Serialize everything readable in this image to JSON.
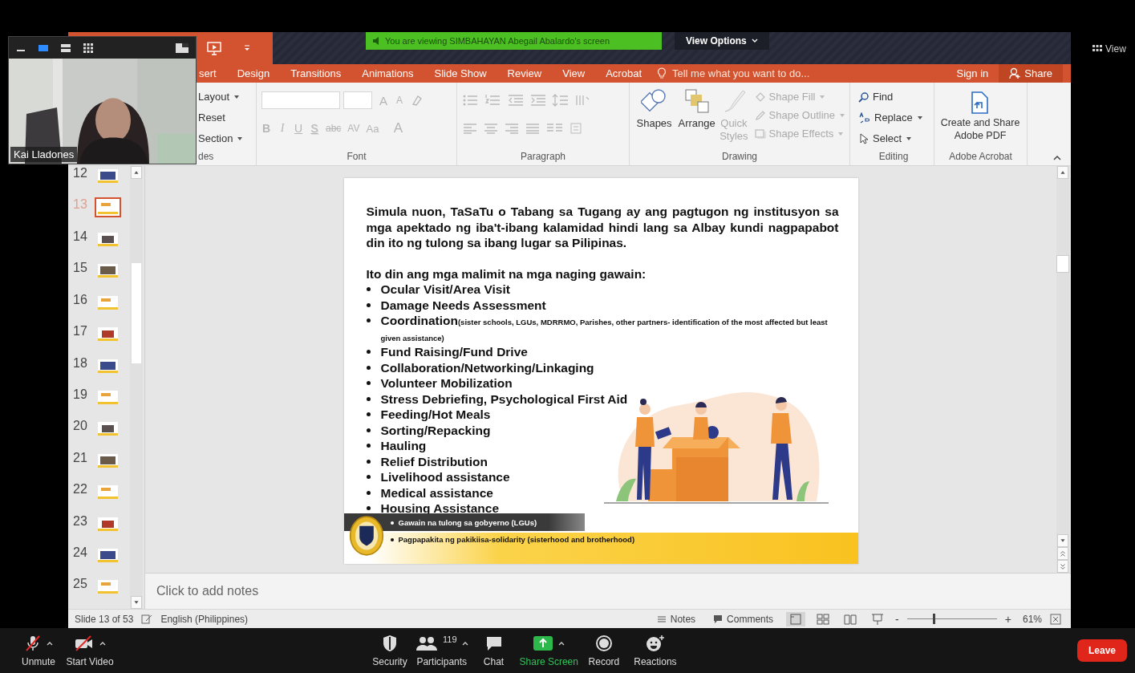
{
  "meeting": {
    "banner": "You are viewing SIMBAHAYAN  Abegail Abalardo's screen",
    "view_options": "View Options",
    "view_button": "View"
  },
  "video_tile": {
    "name": "Kai Lladones"
  },
  "tabs": [
    {
      "label": "sert",
      "selected": false
    },
    {
      "label": "Design",
      "selected": false
    },
    {
      "label": "Transitions",
      "selected": false
    },
    {
      "label": "Animations",
      "selected": false
    },
    {
      "label": "Slide Show",
      "selected": false
    },
    {
      "label": "Review",
      "selected": false
    },
    {
      "label": "View",
      "selected": false
    },
    {
      "label": "Acrobat",
      "selected": false
    }
  ],
  "tell_me": {
    "placeholder": "Tell me what you want to do..."
  },
  "sign_in": "Sign in",
  "share": "Share",
  "ribbon": {
    "slides_group": {
      "label": "des",
      "items": [
        {
          "label": "Layout",
          "menu": true
        },
        {
          "label": "Reset",
          "menu": false
        },
        {
          "label": "Section",
          "menu": true
        }
      ]
    },
    "font_group": {
      "label": "Font",
      "disabled": true,
      "size_buttons": [
        {
          "label": "A",
          "kind": "grow"
        },
        {
          "label": "A",
          "kind": "shrink"
        }
      ],
      "format_buttons": [
        {
          "label": "B",
          "kind": "bold"
        },
        {
          "label": "I",
          "kind": "italic"
        },
        {
          "label": "U",
          "kind": "underline"
        },
        {
          "label": "S",
          "kind": "shadow"
        },
        {
          "label": "abc",
          "kind": "strike"
        },
        {
          "label": "AV",
          "kind": "spacing"
        },
        {
          "label": "Aa",
          "kind": "case"
        },
        {
          "label": "A",
          "kind": "color"
        }
      ]
    },
    "paragraph_group": {
      "label": "Paragraph",
      "disabled": true
    },
    "drawing_group": {
      "label": "Drawing",
      "big_buttons": [
        {
          "label": "Shapes",
          "kind": "shapes",
          "disabled": false
        },
        {
          "label": "Arrange",
          "kind": "arrange",
          "disabled": false
        },
        {
          "label": "Quick Styles",
          "kind": "styles",
          "disabled": true
        }
      ],
      "small_buttons": [
        {
          "label": "Shape Fill",
          "kind": "fill",
          "disabled": true
        },
        {
          "label": "Shape Outline",
          "kind": "outline",
          "disabled": true
        },
        {
          "label": "Shape Effects",
          "kind": "effects",
          "disabled": true
        }
      ]
    },
    "editing_group": {
      "label": "Editing",
      "items": [
        {
          "label": "Find",
          "kind": "find",
          "menu": false
        },
        {
          "label": "Replace",
          "kind": "replace",
          "menu": true
        },
        {
          "label": "Select",
          "kind": "select",
          "menu": true
        }
      ]
    },
    "acrobat_group": {
      "label": "Adobe Acrobat",
      "button": "Create and Share Adobe PDF"
    }
  },
  "slides": [
    {
      "number": "12",
      "selected": false
    },
    {
      "number": "13",
      "selected": true
    },
    {
      "number": "14",
      "selected": false
    },
    {
      "number": "15",
      "selected": false
    },
    {
      "number": "16",
      "selected": false
    },
    {
      "number": "17",
      "selected": false
    },
    {
      "number": "18",
      "selected": false
    },
    {
      "number": "19",
      "selected": false
    },
    {
      "number": "20",
      "selected": false
    },
    {
      "number": "21",
      "selected": false
    },
    {
      "number": "22",
      "selected": false
    },
    {
      "number": "23",
      "selected": false
    },
    {
      "number": "24",
      "selected": false
    },
    {
      "number": "25",
      "selected": false
    }
  ],
  "slide": {
    "paragraph": "Simula nuon, TaSaTu o Tabang sa Tugang ay ang pagtugon ng institusyon sa mga apektado ng iba't-ibang kalamidad hindi lang sa Albay kundi nagpapabot din ito ng tulong sa ibang lugar sa Pilipinas.",
    "heading": "Ito din ang mga malimit na mga naging gawain:",
    "bullets": [
      {
        "text": "Ocular Visit/Area Visit"
      },
      {
        "text": "Damage Needs Assessment"
      },
      {
        "text": "Coordination",
        "note": "(sister schools, LGUs, MDRRMO, Parishes, other partners- identification of the most affected but least given assistance)"
      },
      {
        "text": "Fund Raising/Fund Drive"
      },
      {
        "text": "Collaboration/Networking/Linkaging"
      },
      {
        "text": "Volunteer Mobilization"
      },
      {
        "text": "Stress Debriefing, Psychological First Aid"
      },
      {
        "text": "Feeding/Hot Meals"
      },
      {
        "text": "Sorting/Repacking"
      },
      {
        "text": "Hauling"
      },
      {
        "text": "Relief Distribution"
      },
      {
        "text": "Livelihood assistance"
      },
      {
        "text": "Medical assistance"
      },
      {
        "text": "Housing Assistance"
      }
    ],
    "small_bullets": [
      "Gawain na tulong sa gobyerno (LGUs)",
      "Pagpapakita ng pakikiisa-solidarity (sisterhood and brotherhood)"
    ]
  },
  "notes": {
    "placeholder": "Click to add notes"
  },
  "status": {
    "slide": "Slide 13 of 53",
    "language": "English (Philippines)",
    "notes": "Notes",
    "comments": "Comments",
    "zoom_out": "-",
    "zoom_in": "+",
    "zoom": {
      "level": 0.29
    },
    "zoom_text": "61%"
  },
  "toolbar": [
    {
      "label": "Unmute",
      "kind": "mic",
      "caret": true
    },
    {
      "label": "Start Video",
      "kind": "video",
      "caret": true
    },
    {
      "label": "Security",
      "kind": "security",
      "caret": false
    },
    {
      "label": "Participants",
      "kind": "participants",
      "count": "119",
      "caret": true
    },
    {
      "label": "Chat",
      "kind": "chat",
      "caret": false
    },
    {
      "label": "Share Screen",
      "kind": "share",
      "caret": true
    },
    {
      "label": "Record",
      "kind": "record",
      "caret": false
    },
    {
      "label": "Reactions",
      "kind": "reactions",
      "caret": false
    }
  ],
  "leave": "Leave"
}
